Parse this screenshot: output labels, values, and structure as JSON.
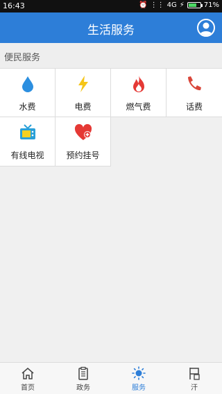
{
  "status_bar": {
    "time": "16:43",
    "network": "4G",
    "battery": "71%",
    "battery_level": 0.71
  },
  "header": {
    "title": "生活服务",
    "avatar_icon": "user-icon"
  },
  "section": {
    "title": "便民服务"
  },
  "services": [
    {
      "label": "水费",
      "icon": "water-drop-icon"
    },
    {
      "label": "电费",
      "icon": "lightning-icon"
    },
    {
      "label": "燃气费",
      "icon": "flame-icon"
    },
    {
      "label": "话费",
      "icon": "phone-icon"
    },
    {
      "label": "有线电视",
      "icon": "tv-icon"
    },
    {
      "label": "预约挂号",
      "icon": "heart-plus-icon"
    }
  ],
  "bottom_nav": [
    {
      "label": "首页",
      "icon": "home-icon",
      "active": false
    },
    {
      "label": "政务",
      "icon": "clipboard-icon",
      "active": false
    },
    {
      "label": "服务",
      "icon": "sun-icon",
      "active": true
    },
    {
      "label": "汗",
      "icon": "flag-icon",
      "active": false
    }
  ],
  "colors": {
    "primary": "#2d7ed8",
    "water": "#2c8fe0",
    "electric": "#f5c518",
    "flame": "#e53935",
    "phone": "#d9463a",
    "tv": "#2aa0d8",
    "heart": "#e53935"
  }
}
